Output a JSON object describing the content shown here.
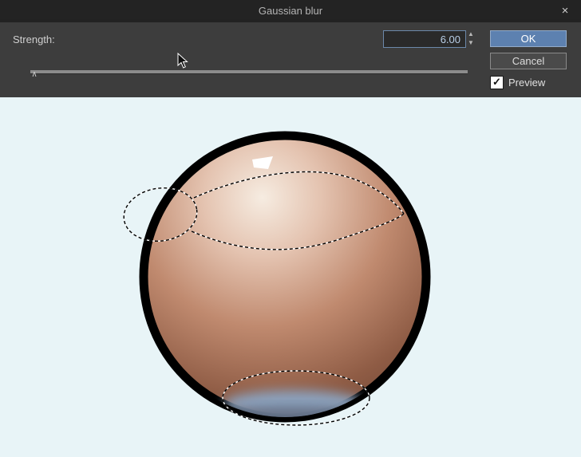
{
  "window": {
    "title": "Gaussian blur",
    "close_glyph": "×"
  },
  "dialog": {
    "strength_label": "Strength:",
    "strength_value": "6.00",
    "ok_label": "OK",
    "cancel_label": "Cancel",
    "preview_label": "Preview",
    "preview_checked": true,
    "check_glyph": "✓",
    "spinner_up_glyph": "▲",
    "spinner_down_glyph": "▼",
    "slider_thumb_glyph": "∧"
  },
  "colors": {
    "titlebar_bg": "#232323",
    "dialog_bg": "#3d3d3d",
    "accent_ok": "#5d81b0",
    "canvas_bg": "#e8f4f7"
  },
  "sphere": {
    "outline": "#000000",
    "gradient": {
      "s0": "#f6ece1",
      "s1": "#e4c3b0",
      "s2": "#c08a6f",
      "s3": "#8f5c45",
      "s4": "#684231"
    },
    "highlight": "#ffffff",
    "bottom_band_blue": "#8ba0bb",
    "bottom_band_dark": "#66738a"
  }
}
